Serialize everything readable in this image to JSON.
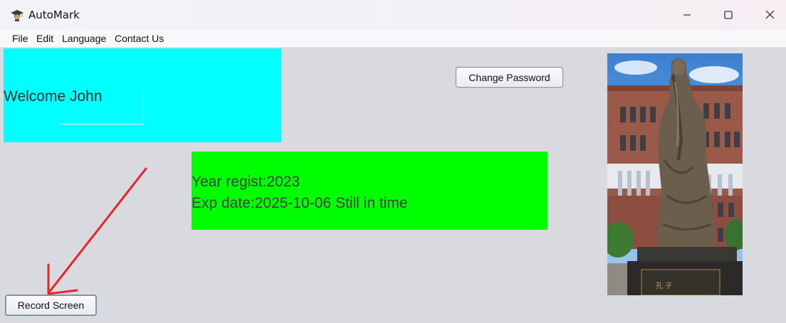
{
  "window": {
    "title": "AutoMark",
    "icon": "graduation-cap-icon"
  },
  "window_controls": {
    "minimize_icon": "minimize-icon",
    "maximize_icon": "maximize-icon",
    "close_icon": "close-icon"
  },
  "menubar": {
    "items": [
      {
        "label": "File"
      },
      {
        "label": "Edit"
      },
      {
        "label": "Language"
      },
      {
        "label": "Contact Us"
      }
    ]
  },
  "welcome": {
    "text": "Welcome John",
    "background": "#00ffff"
  },
  "buttons": {
    "change_password": "Change Password",
    "record_screen": "Record Screen"
  },
  "info": {
    "year_regist": "Year regist:2023",
    "exp_date": "Exp date:2025-10-06 Still in time",
    "background": "#00ff00"
  },
  "photo": {
    "description_icon": "statue-photo"
  },
  "annotation": {
    "arrow_color": "#e8232a"
  }
}
